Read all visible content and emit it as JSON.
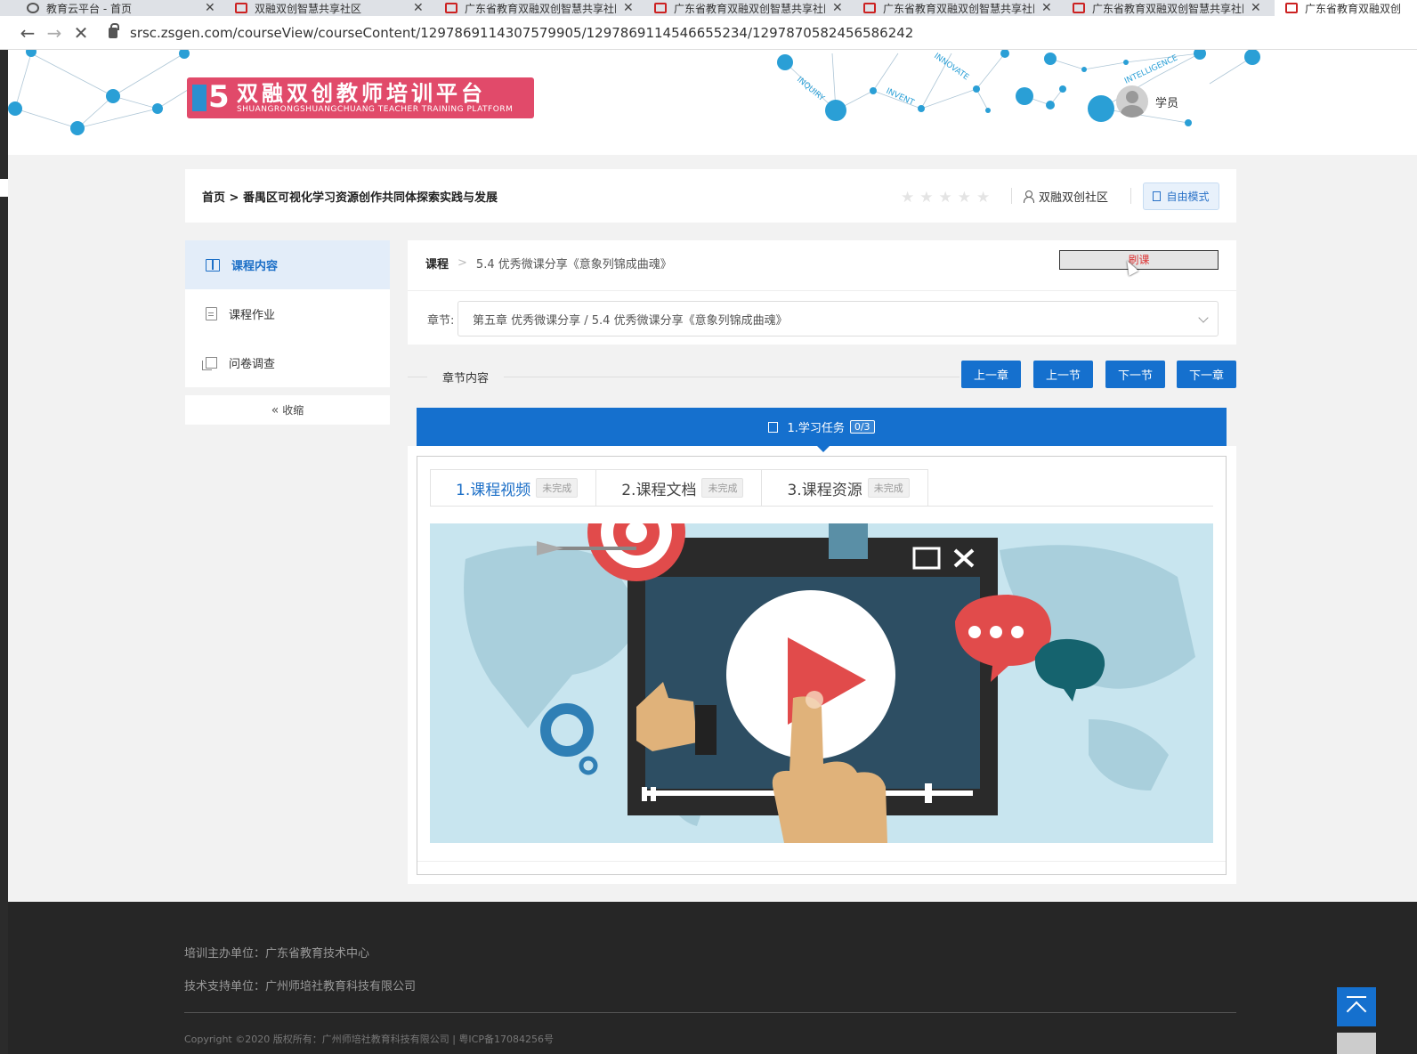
{
  "browser": {
    "tabs": [
      {
        "label": "教育云平台 - 首页",
        "icon": "globe-icon"
      },
      {
        "label": "双融双创智慧共享社区",
        "icon": "site-logo-icon"
      },
      {
        "label": "广东省教育双融双创智慧共享社区",
        "icon": "site-logo-icon"
      },
      {
        "label": "广东省教育双融双创智慧共享社区",
        "icon": "site-logo-icon"
      },
      {
        "label": "广东省教育双融双创智慧共享社区",
        "icon": "site-logo-icon"
      },
      {
        "label": "广东省教育双融双创智慧共享社区",
        "icon": "site-logo-icon"
      },
      {
        "label": "广东省教育双融双创",
        "icon": "site-logo-icon"
      }
    ],
    "close_glyph": "✕",
    "url": "srsc.zsgen.com/courseView/courseContent/1297869114307579905/1297869114546655234/1297870582456586242"
  },
  "header": {
    "logo_cn": "双融双创教师培训平台",
    "logo_en": "SHUANGRONGSHUANGCHUANG TEACHER TRAINING PLATFORM",
    "logo_mark": "5",
    "network_words": [
      "INQUIRY",
      "INNOVATE",
      "INVENT",
      "INTELLIGENCE"
    ],
    "user_name": "学员"
  },
  "breadcrumb": {
    "text": "首页 > 番禺区可视化学习资源创作共同体探索实践与发展",
    "stars": "★★★★★",
    "rating": 0,
    "community": "双融双创社区",
    "free_mode": "自由模式"
  },
  "sidebar": {
    "items": [
      {
        "label": "课程内容",
        "icon": "book-icon",
        "active": true
      },
      {
        "label": "课程作业",
        "icon": "document-icon",
        "active": false
      },
      {
        "label": "问卷调查",
        "icon": "survey-icon",
        "active": false
      }
    ],
    "collapse_glyph": "«",
    "collapse_label": "收缩"
  },
  "main": {
    "crumb_root": "课程",
    "crumb_sep": ">",
    "crumb_current": "5.4 优秀微课分享《意象列锦成曲魂》",
    "read_button": "刷课",
    "chapter_label": "章节:",
    "chapter_value": "第五章 优秀微课分享 / 5.4 优秀微课分享《意象列锦成曲魂》",
    "section_title": "章节内容",
    "nav_buttons": [
      "上一章",
      "上一节",
      "下一节",
      "下一章"
    ],
    "task_label": "1.学习任务",
    "task_badge": "0/3",
    "content_tabs": [
      {
        "label": "1.课程视频",
        "status": "未完成",
        "active": true
      },
      {
        "label": "2.课程文档",
        "status": "未完成",
        "active": false
      },
      {
        "label": "3.课程资源",
        "status": "未完成",
        "active": false
      }
    ]
  },
  "footer": {
    "organizer": "培训主办单位：广东省教育技术中心",
    "support": "技术支持单位：广州师培社教育科技有限公司",
    "copyright": "Copyright ©2020 版权所有：广州师培社教育科技有限公司 | 粤ICP备17084256号"
  },
  "colors": {
    "primary": "#1570ce",
    "logo_bg": "#e14a6a",
    "footer_bg": "#262626",
    "sidebar_active_bg": "#e3edf9"
  }
}
